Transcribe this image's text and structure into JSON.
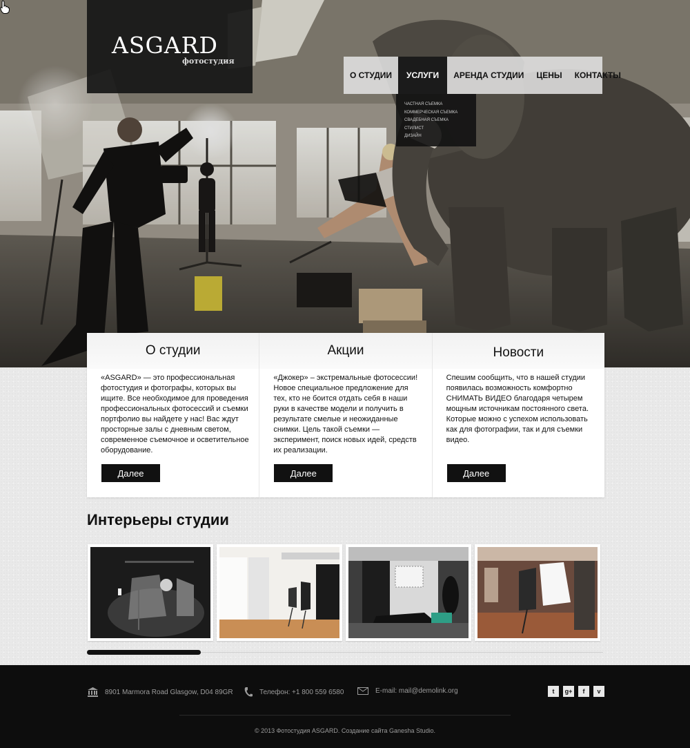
{
  "logo": {
    "title": "ASGARD",
    "subtitle": "фотостудия"
  },
  "nav": {
    "items": [
      {
        "label": "О СТУДИИ"
      },
      {
        "label": "УСЛУГИ"
      },
      {
        "label": "АРЕНДА СТУДИИ"
      },
      {
        "label": "ЦЕНЫ"
      },
      {
        "label": "КОНТАКТЫ"
      }
    ],
    "active": "УСЛУГИ",
    "dropdown": [
      {
        "label": "ЧАСТНАЯ СЪЕМКА"
      },
      {
        "label": "КОММЕРЧЕСКАЯ СЪЕМКА"
      },
      {
        "label": "СВАДЕБНАЯ СЪЕМКА"
      },
      {
        "label": "СТИЛИСТ"
      },
      {
        "label": "ДИЗАЙН"
      }
    ]
  },
  "boxes": [
    {
      "title": "О студии",
      "text": "«ASGARD» — это профессиональная фотостудия и фотографы, которых вы ищите. Все необходимое для проведения профессиональных фотосессий и съемки портфолио вы найдете у нас! Вас ждут просторные залы с дневным светом, современное съемочное и осветительное оборудование.",
      "button": "Далее"
    },
    {
      "title": "Акции",
      "text": "«Джокер» – экстремальные фотосессии! Новое специальное предложение для тех, кто не боится отдать себя в наши руки в качестве модели и получить в результате смелые и неожиданные снимки. Цель такой съемки — эксперимент, поиск новых идей, средств их реализации.",
      "button": "Далее"
    },
    {
      "title": "Новости",
      "text": "Спешим сообщить, что в нашей студии появилась возможность комфортно СНИМАТЬ ВИДЕО благодаря четырем мощным источникам постоянного света. Которые можно с успехом использовать как для фотографии, так и для съемки видео.",
      "button": "Далее"
    }
  ],
  "gallery": {
    "title": "Интерьеры студии",
    "scroll_position": 0.22
  },
  "footer": {
    "address": "8901 Marmora Road Glasgow, D04 89GR",
    "phone": "Телефон:  +1 800 559 6580",
    "email": "E-mail: mail@demolink.org",
    "copyright": "© 2013  Фотостудия ASGARD. Создание сайта Ganesha Studio.",
    "social": [
      {
        "name": "twitter-icon",
        "glyph": "t"
      },
      {
        "name": "google-plus-icon",
        "glyph": "g+"
      },
      {
        "name": "facebook-icon",
        "glyph": "f"
      },
      {
        "name": "vimeo-icon",
        "glyph": "v"
      }
    ]
  },
  "colors": {
    "dark": "#111111",
    "nav_bg": "#e1e1e1",
    "footer_bg": "#0d0d0d"
  }
}
